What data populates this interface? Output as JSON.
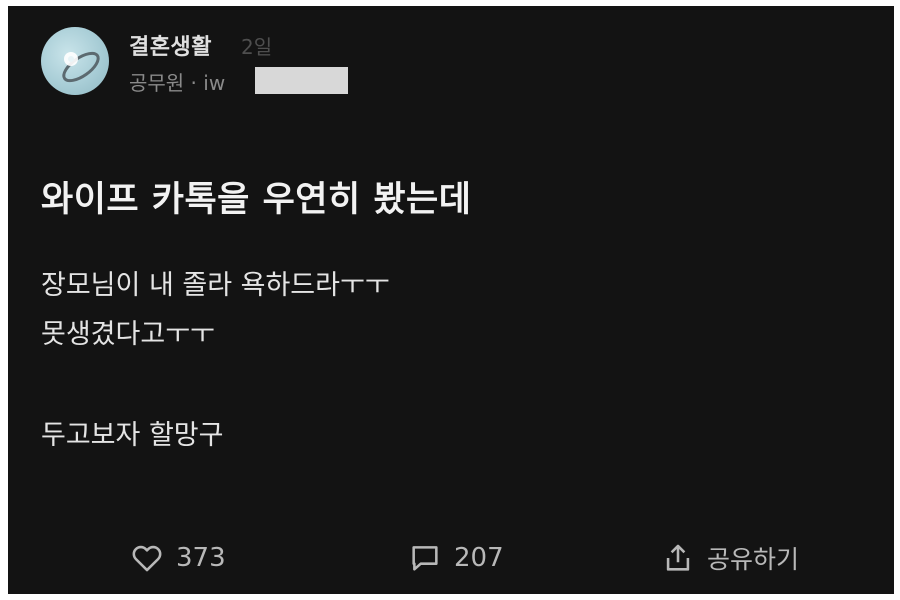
{
  "board": {
    "name": "결혼생활",
    "time": "2일"
  },
  "author": {
    "text": "공무원 · iw"
  },
  "post": {
    "title": "와이프 카톡을 우연히 봤는데",
    "body": [
      "장모님이 내 졸라 욕하드라ㅜㅜ",
      "못생겼다고ㅜㅜ",
      "두고보자 할망구"
    ]
  },
  "actions": {
    "likes": "373",
    "comments": "207",
    "share_label": "공유하기"
  },
  "icons": {
    "like": "heart-icon",
    "comment": "comment-bubble-icon",
    "share": "share-icon",
    "avatar": "ring-image"
  },
  "colors": {
    "background": "#131313",
    "text": "#ededed",
    "muted": "#8a8a8a",
    "avatar": "#a8cdd6"
  }
}
